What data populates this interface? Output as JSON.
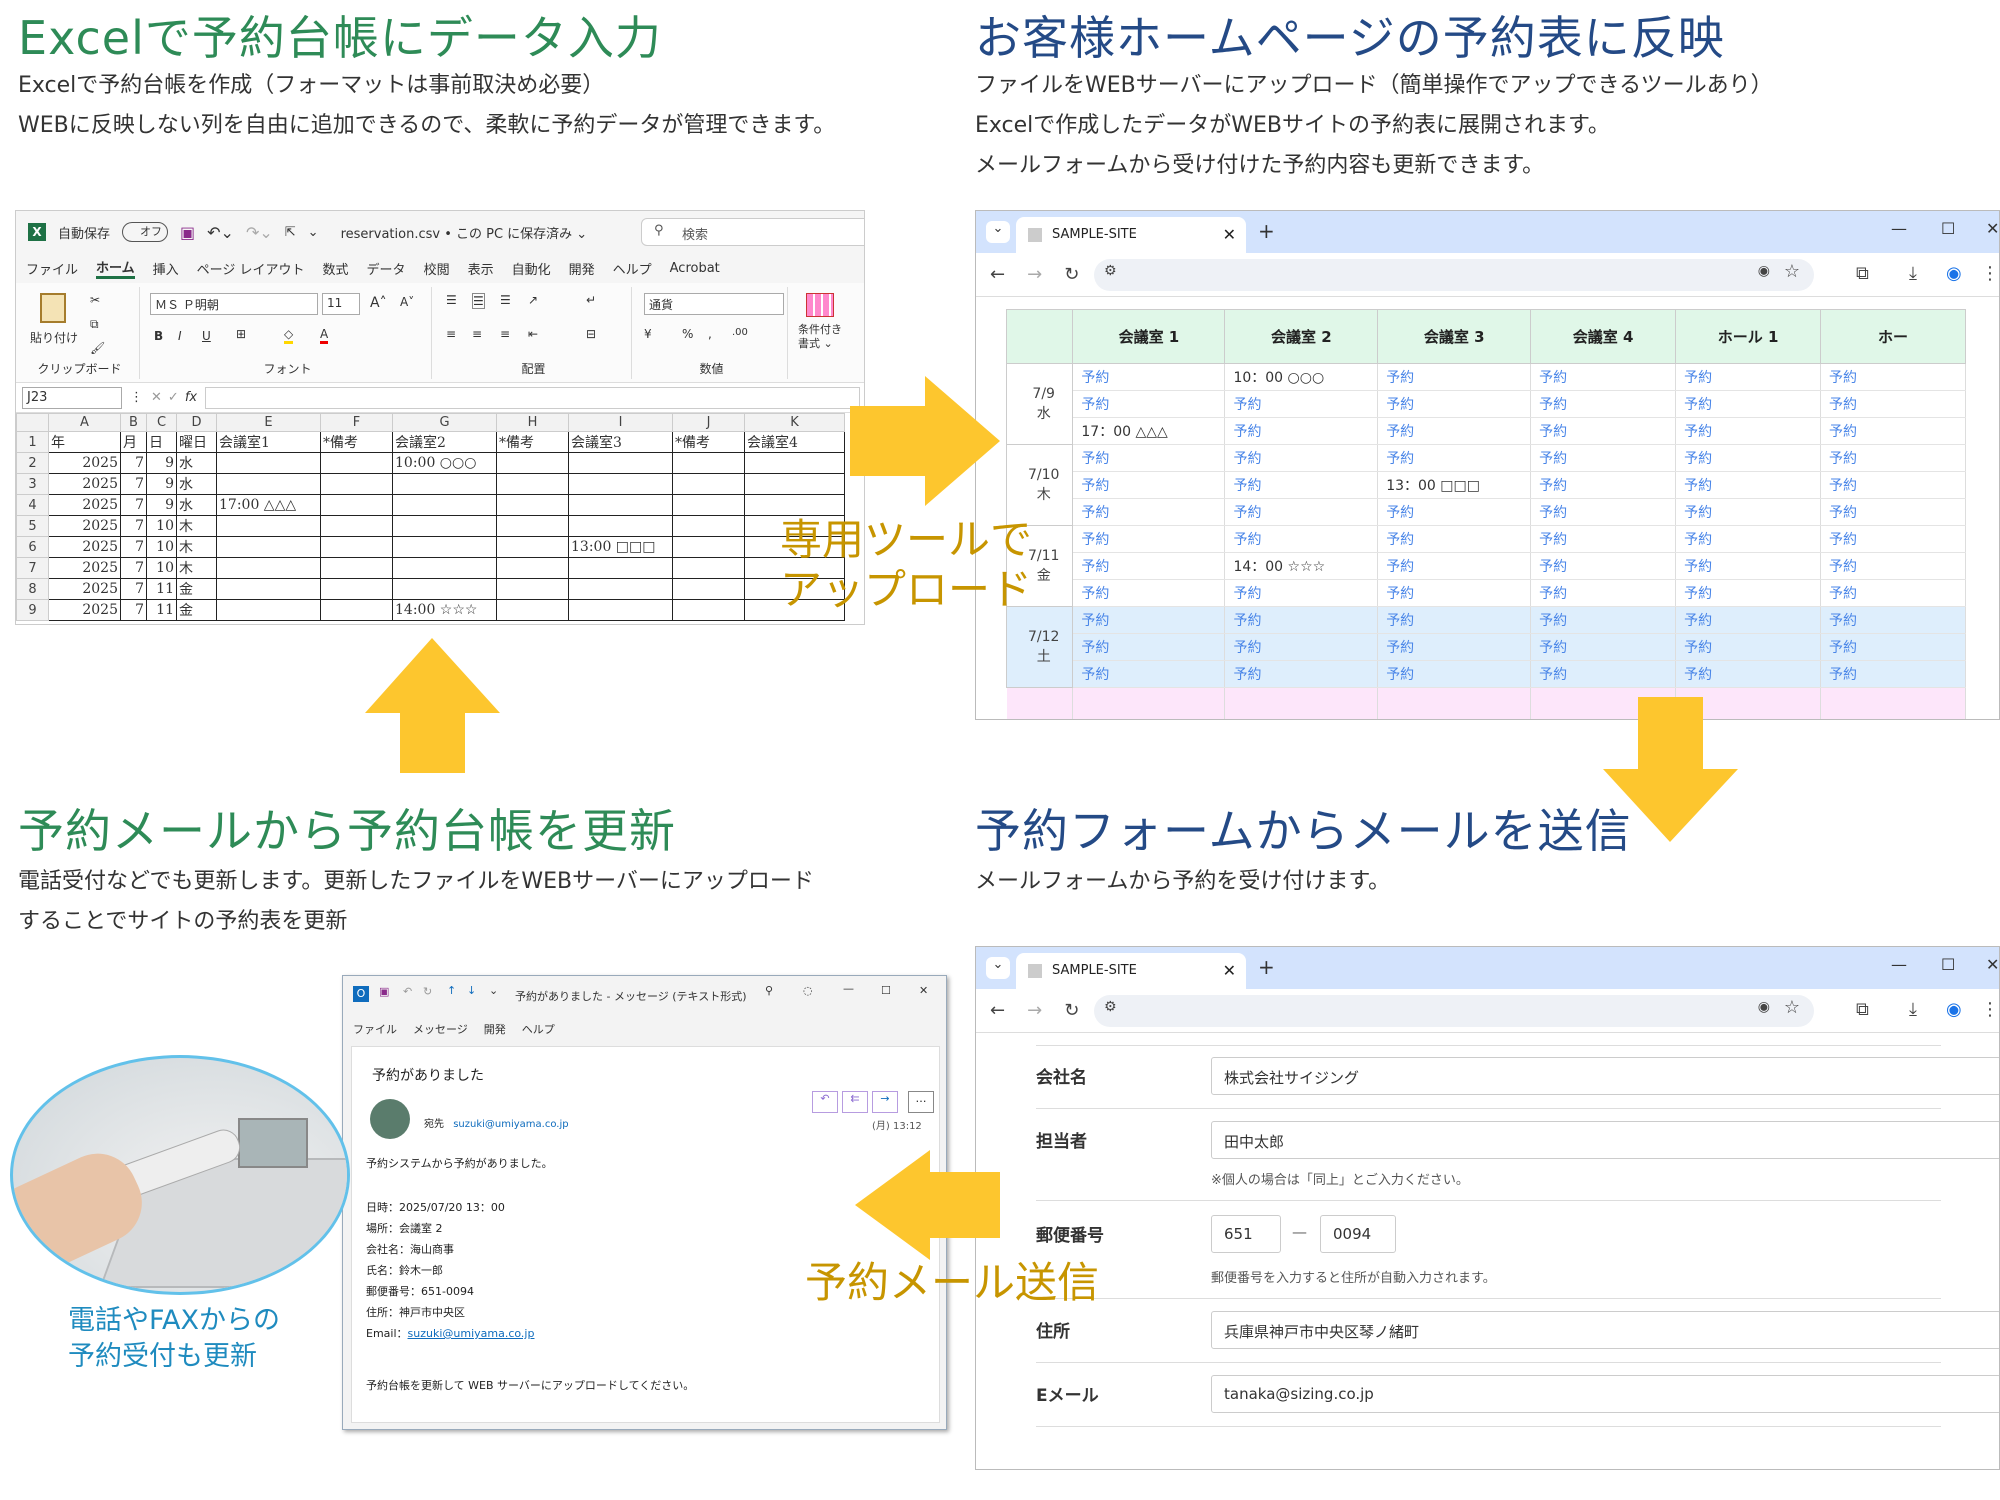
{
  "sections": {
    "s1": {
      "title": "Excelで予約台帳にデータ入力",
      "lines": [
        "Excelで予約台帳を作成（フォーマットは事前取決め必要）",
        "WEBに反映しない列を自由に追加できるので、柔軟に予約データが管理できます。"
      ]
    },
    "s2": {
      "title": "お客様ホームページの予約表に反映",
      "lines": [
        "ファイルをWEBサーバーにアップロード（簡単操作でアップできるツールあり）",
        "Excelで作成したデータがWEBサイトの予約表に展開されます。",
        "メールフォームから受け付けた予約内容も更新できます。"
      ]
    },
    "s3": {
      "title": "予約メールから予約台帳を更新",
      "lines": [
        "電話受付などでも更新します。更新したファイルをWEBサーバーにアップロード",
        "することでサイトの予約表を更新"
      ]
    },
    "s4": {
      "title": "予約フォームからメールを送信",
      "lines": [
        "メールフォームから予約を受け付けます。"
      ]
    }
  },
  "arrow_labels": {
    "upload": [
      "専用ツールで",
      "アップロード"
    ],
    "mail": "予約メール送信"
  },
  "phone_caption": [
    "電話やFAXからの",
    "予約受付も更新"
  ],
  "excel": {
    "autosave": "自動保存",
    "toggle": "オフ",
    "filename": "reservation.csv • この PC に保存済み ⌄",
    "search": "検索",
    "menu": [
      "ファイル",
      "ホーム",
      "挿入",
      "ページ レイアウト",
      "数式",
      "データ",
      "校閲",
      "表示",
      "自動化",
      "開発",
      "ヘルプ",
      "Acrobat"
    ],
    "paste": "貼り付け",
    "clipboard": "クリップボード",
    "font_name": "ＭＳ Ｐ明朝",
    "font_size": "11",
    "font_group": "フォント",
    "align_group": "配置",
    "number_format": "通貨",
    "number_group": "数値",
    "cond_format": "条件付き書式 ⌄",
    "namebox": "J23",
    "fx": "fx",
    "col_letters": [
      "",
      "A",
      "B",
      "C",
      "D",
      "E",
      "F",
      "G",
      "H",
      "I",
      "J",
      "K"
    ],
    "header_row": [
      "1",
      "年",
      "月",
      "日",
      "曜日",
      "会議室1",
      "*備考",
      "会議室2",
      "*備考",
      "会議室3",
      "*備考",
      "会議室4"
    ],
    "rows": [
      [
        "2",
        "2025",
        "7",
        "9",
        "水",
        "",
        "",
        "10:00 ○○○",
        "",
        "",
        "",
        ""
      ],
      [
        "3",
        "2025",
        "7",
        "9",
        "水",
        "",
        "",
        "",
        "",
        "",
        "",
        ""
      ],
      [
        "4",
        "2025",
        "7",
        "9",
        "水",
        "17:00 △△△",
        "",
        "",
        "",
        "",
        "",
        ""
      ],
      [
        "5",
        "2025",
        "7",
        "10",
        "木",
        "",
        "",
        "",
        "",
        "",
        "",
        ""
      ],
      [
        "6",
        "2025",
        "7",
        "10",
        "木",
        "",
        "",
        "",
        "",
        "13:00 □□□",
        "",
        ""
      ],
      [
        "7",
        "2025",
        "7",
        "10",
        "木",
        "",
        "",
        "",
        "",
        "",
        "",
        ""
      ],
      [
        "8",
        "2025",
        "7",
        "11",
        "金",
        "",
        "",
        "",
        "",
        "",
        "",
        ""
      ],
      [
        "9",
        "2025",
        "7",
        "11",
        "金",
        "",
        "",
        "14:00 ☆☆☆",
        "",
        "",
        "",
        ""
      ]
    ]
  },
  "browser": {
    "tab": "SAMPLE-SITE"
  },
  "reservation": {
    "headers": [
      "会議室 1",
      "会議室 2",
      "会議室 3",
      "会議室 4",
      "ホール 1",
      "ホー"
    ],
    "link": "予約",
    "days": [
      {
        "date": "7/9",
        "dow": "水",
        "bg": "#ffffff",
        "slots": [
          [
            "予約",
            "10：00 ○○○",
            "予約",
            "予約",
            "予約",
            "予約"
          ],
          [
            "予約",
            "予約",
            "予約",
            "予約",
            "予約",
            "予約"
          ],
          [
            "17：00 △△△",
            "予約",
            "予約",
            "予約",
            "予約",
            "予約"
          ]
        ]
      },
      {
        "date": "7/10",
        "dow": "木",
        "bg": "#ffffff",
        "slots": [
          [
            "予約",
            "予約",
            "予約",
            "予約",
            "予約",
            "予約"
          ],
          [
            "予約",
            "予約",
            "13：00 □□□",
            "予約",
            "予約",
            "予約"
          ],
          [
            "予約",
            "予約",
            "予約",
            "予約",
            "予約",
            "予約"
          ]
        ]
      },
      {
        "date": "7/11",
        "dow": "金",
        "bg": "#ffffff",
        "slots": [
          [
            "予約",
            "予約",
            "予約",
            "予約",
            "予約",
            "予約"
          ],
          [
            "予約",
            "14：00 ☆☆☆",
            "予約",
            "予約",
            "予約",
            "予約"
          ],
          [
            "予約",
            "予約",
            "予約",
            "予約",
            "予約",
            "予約"
          ]
        ]
      },
      {
        "date": "7/12",
        "dow": "土",
        "bg": "#deeefc",
        "slots": [
          [
            "予約",
            "予約",
            "予約",
            "予約",
            "予約",
            "予約"
          ],
          [
            "予約",
            "予約",
            "予約",
            "予約",
            "予約",
            "予約"
          ],
          [
            "予約",
            "予約",
            "予約",
            "予約",
            "予約",
            "予約"
          ]
        ]
      }
    ],
    "next_bg": "#fde6fa"
  },
  "form": {
    "company_label": "会社名",
    "company_value": "株式会社サイジング",
    "person_label": "担当者",
    "person_value": "田中太郎",
    "person_note": "※個人の場合は「同上」とご入力ください。",
    "zip_label": "郵便番号",
    "zip1": "651",
    "zip_dash": "—",
    "zip2": "0094",
    "zip_note": "郵便番号を入力すると住所が自動入力されます。",
    "address_label": "住所",
    "address_value": "兵庫県神戸市中央区琴ノ緒町",
    "email_label": "Eメール",
    "email_value": "tanaka@sizing.co.jp"
  },
  "mail": {
    "title": "予約がありました - メッセージ (テキスト形式)",
    "menu": [
      "ファイル",
      "メッセージ",
      "開発",
      "ヘルプ"
    ],
    "subject": "予約がありました",
    "to_label": "宛先",
    "to": "suzuki@umiyama.co.jp",
    "time": "(月) 13:12",
    "body_intro": "予約システムから予約がありました。",
    "body_lines": [
      "日時：2025/07/20 13：00",
      "場所：会議室 2",
      "会社名：海山商事",
      "氏名：鈴木一郎",
      "郵便番号：651-0094",
      "住所：神戸市中央区"
    ],
    "email_label": "Email：",
    "email": "suzuki@umiyama.co.jp",
    "footer": "予約台帳を更新して WEB サーバーにアップロードしてください。"
  },
  "colors": {
    "green": "#2e8b57",
    "blue": "#244a86",
    "arrow": "#fdc62e",
    "gold_text": "#c79500",
    "link": "#4a86e8"
  }
}
